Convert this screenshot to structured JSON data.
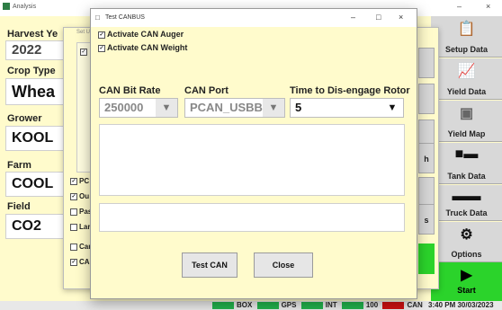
{
  "main_window": {
    "title": "Analysis",
    "controls": [
      "–",
      "□",
      "×"
    ],
    "fields": {
      "harvest_year_label": "Harvest Ye",
      "harvest_year_value": "2022",
      "crop_type_label": "Crop Type",
      "crop_type_value": "Whea",
      "grower_label": "Grower",
      "grower_value": "KOOL",
      "farm_label": "Farm",
      "farm_value": "COOL",
      "field_label": "Field",
      "field_value": "CO2"
    }
  },
  "nav": [
    {
      "label": "Setup Data",
      "icon": "clipboard-icon"
    },
    {
      "label": "Yield Data",
      "icon": "chart-icon"
    },
    {
      "label": "Yield Map",
      "icon": "map-icon"
    },
    {
      "label": "Tank Data",
      "icon": "tank-icon"
    },
    {
      "label": "Truck Data",
      "icon": "truck-icon"
    },
    {
      "label": "Options",
      "icon": "gear-icon"
    }
  ],
  "start_button": {
    "label": "Start",
    "icon": "play-icon",
    "color": "#2bd32b"
  },
  "status_bar": {
    "items": [
      {
        "label": "BOX",
        "color": "#22b14c"
      },
      {
        "label": "GPS",
        "color": "#22b14c"
      },
      {
        "label": "INT",
        "color": "#22b14c"
      },
      {
        "label": "100",
        "color": "#22b14c"
      },
      {
        "label": "CAN",
        "color": "#cc1111"
      }
    ],
    "time": "3:40 PM",
    "date": "30/03/2023"
  },
  "setup_dialog": {
    "title": "Set Up",
    "checkboxes": [
      {
        "label": "PC",
        "checked": true
      },
      {
        "label": "Ou",
        "checked": true
      },
      {
        "label": "Pas",
        "checked": false
      },
      {
        "label": "Lar",
        "checked": false
      },
      {
        "label": "Car",
        "checked": false
      },
      {
        "label": "CA",
        "checked": true
      }
    ],
    "right_buttons": [
      "h",
      "s"
    ]
  },
  "canbus_dialog": {
    "title": "Test CANBUS",
    "controls": [
      "–",
      "□",
      "×"
    ],
    "activate_auger": {
      "label": "Activate CAN Auger",
      "checked": true
    },
    "activate_weight": {
      "label": "Activate CAN Weight",
      "checked": true
    },
    "bit_rate": {
      "label": "CAN Bit Rate",
      "value": "250000"
    },
    "port": {
      "label": "CAN Port",
      "value": "PCAN_USBBU"
    },
    "rotor_time": {
      "label": "Time to Dis-engage Rotor",
      "value": "5"
    },
    "test_button": "Test CAN",
    "close_button": "Close"
  }
}
